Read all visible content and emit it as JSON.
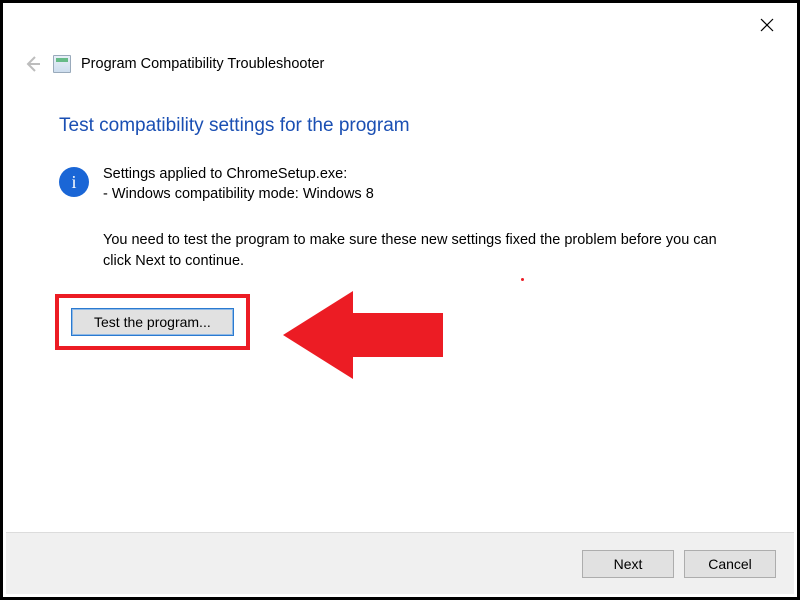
{
  "window": {
    "title": "Program Compatibility Troubleshooter"
  },
  "heading": "Test compatibility settings for the program",
  "info": {
    "line1": "Settings applied to ChromeSetup.exe:",
    "line2": "- Windows compatibility mode: Windows 8"
  },
  "hint": "You need to test the program to make sure these new settings fixed the problem before you can click Next to continue.",
  "buttons": {
    "test": "Test the program...",
    "next": "Next",
    "cancel": "Cancel"
  }
}
